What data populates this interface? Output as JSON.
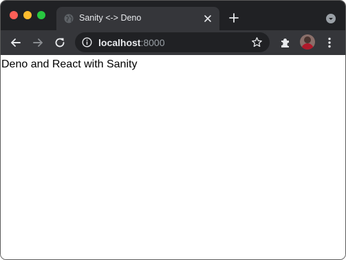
{
  "browser": {
    "tab": {
      "title": "Sanity <-> Deno",
      "favicon": "globe-icon"
    },
    "toolbar": {
      "back_icon": "arrow-left-icon",
      "forward_icon": "arrow-right-icon",
      "reload_icon": "reload-icon",
      "extensions_icon": "puzzle-icon",
      "menu_icon": "kebab-menu-icon",
      "bookmark_icon": "star-icon"
    },
    "address_bar": {
      "host": "localhost",
      "port": ":8000",
      "site_info_icon": "info-icon"
    }
  },
  "page": {
    "text": "Deno and React with Sanity"
  },
  "colors": {
    "tab_strip": "#202124",
    "active_tab": "#35363a",
    "toolbar": "#35363a",
    "omnibox": "#202124",
    "close_button": "#ff5f57",
    "minimize_button": "#febc2e",
    "maximize_button": "#28c840"
  }
}
